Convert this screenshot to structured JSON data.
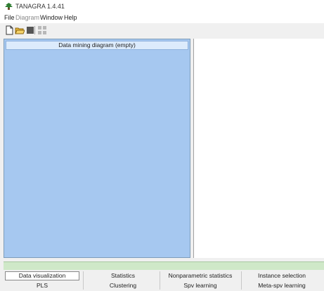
{
  "window": {
    "title": "TANAGRA 1.4.41"
  },
  "menu": {
    "items": [
      "File",
      "Diagram",
      "Window",
      "Help"
    ]
  },
  "toolbar": {
    "buttons": [
      "new-icon",
      "open-icon",
      "save-icon",
      "diagram-icon"
    ]
  },
  "diagram": {
    "header": "Data mining diagram (empty)"
  },
  "tabs": {
    "row1": [
      "Data visualization",
      "Statistics",
      "Nonparametric statistics",
      "Instance selection"
    ],
    "row2": [
      "PLS",
      "Clustering",
      "Spv learning",
      "Meta-spv learning"
    ],
    "active": "Data visualization"
  },
  "colors": {
    "diagram_bg": "#a6c8f0",
    "header_bg": "#dcebfc",
    "status_strip": "#cfe8c8"
  }
}
